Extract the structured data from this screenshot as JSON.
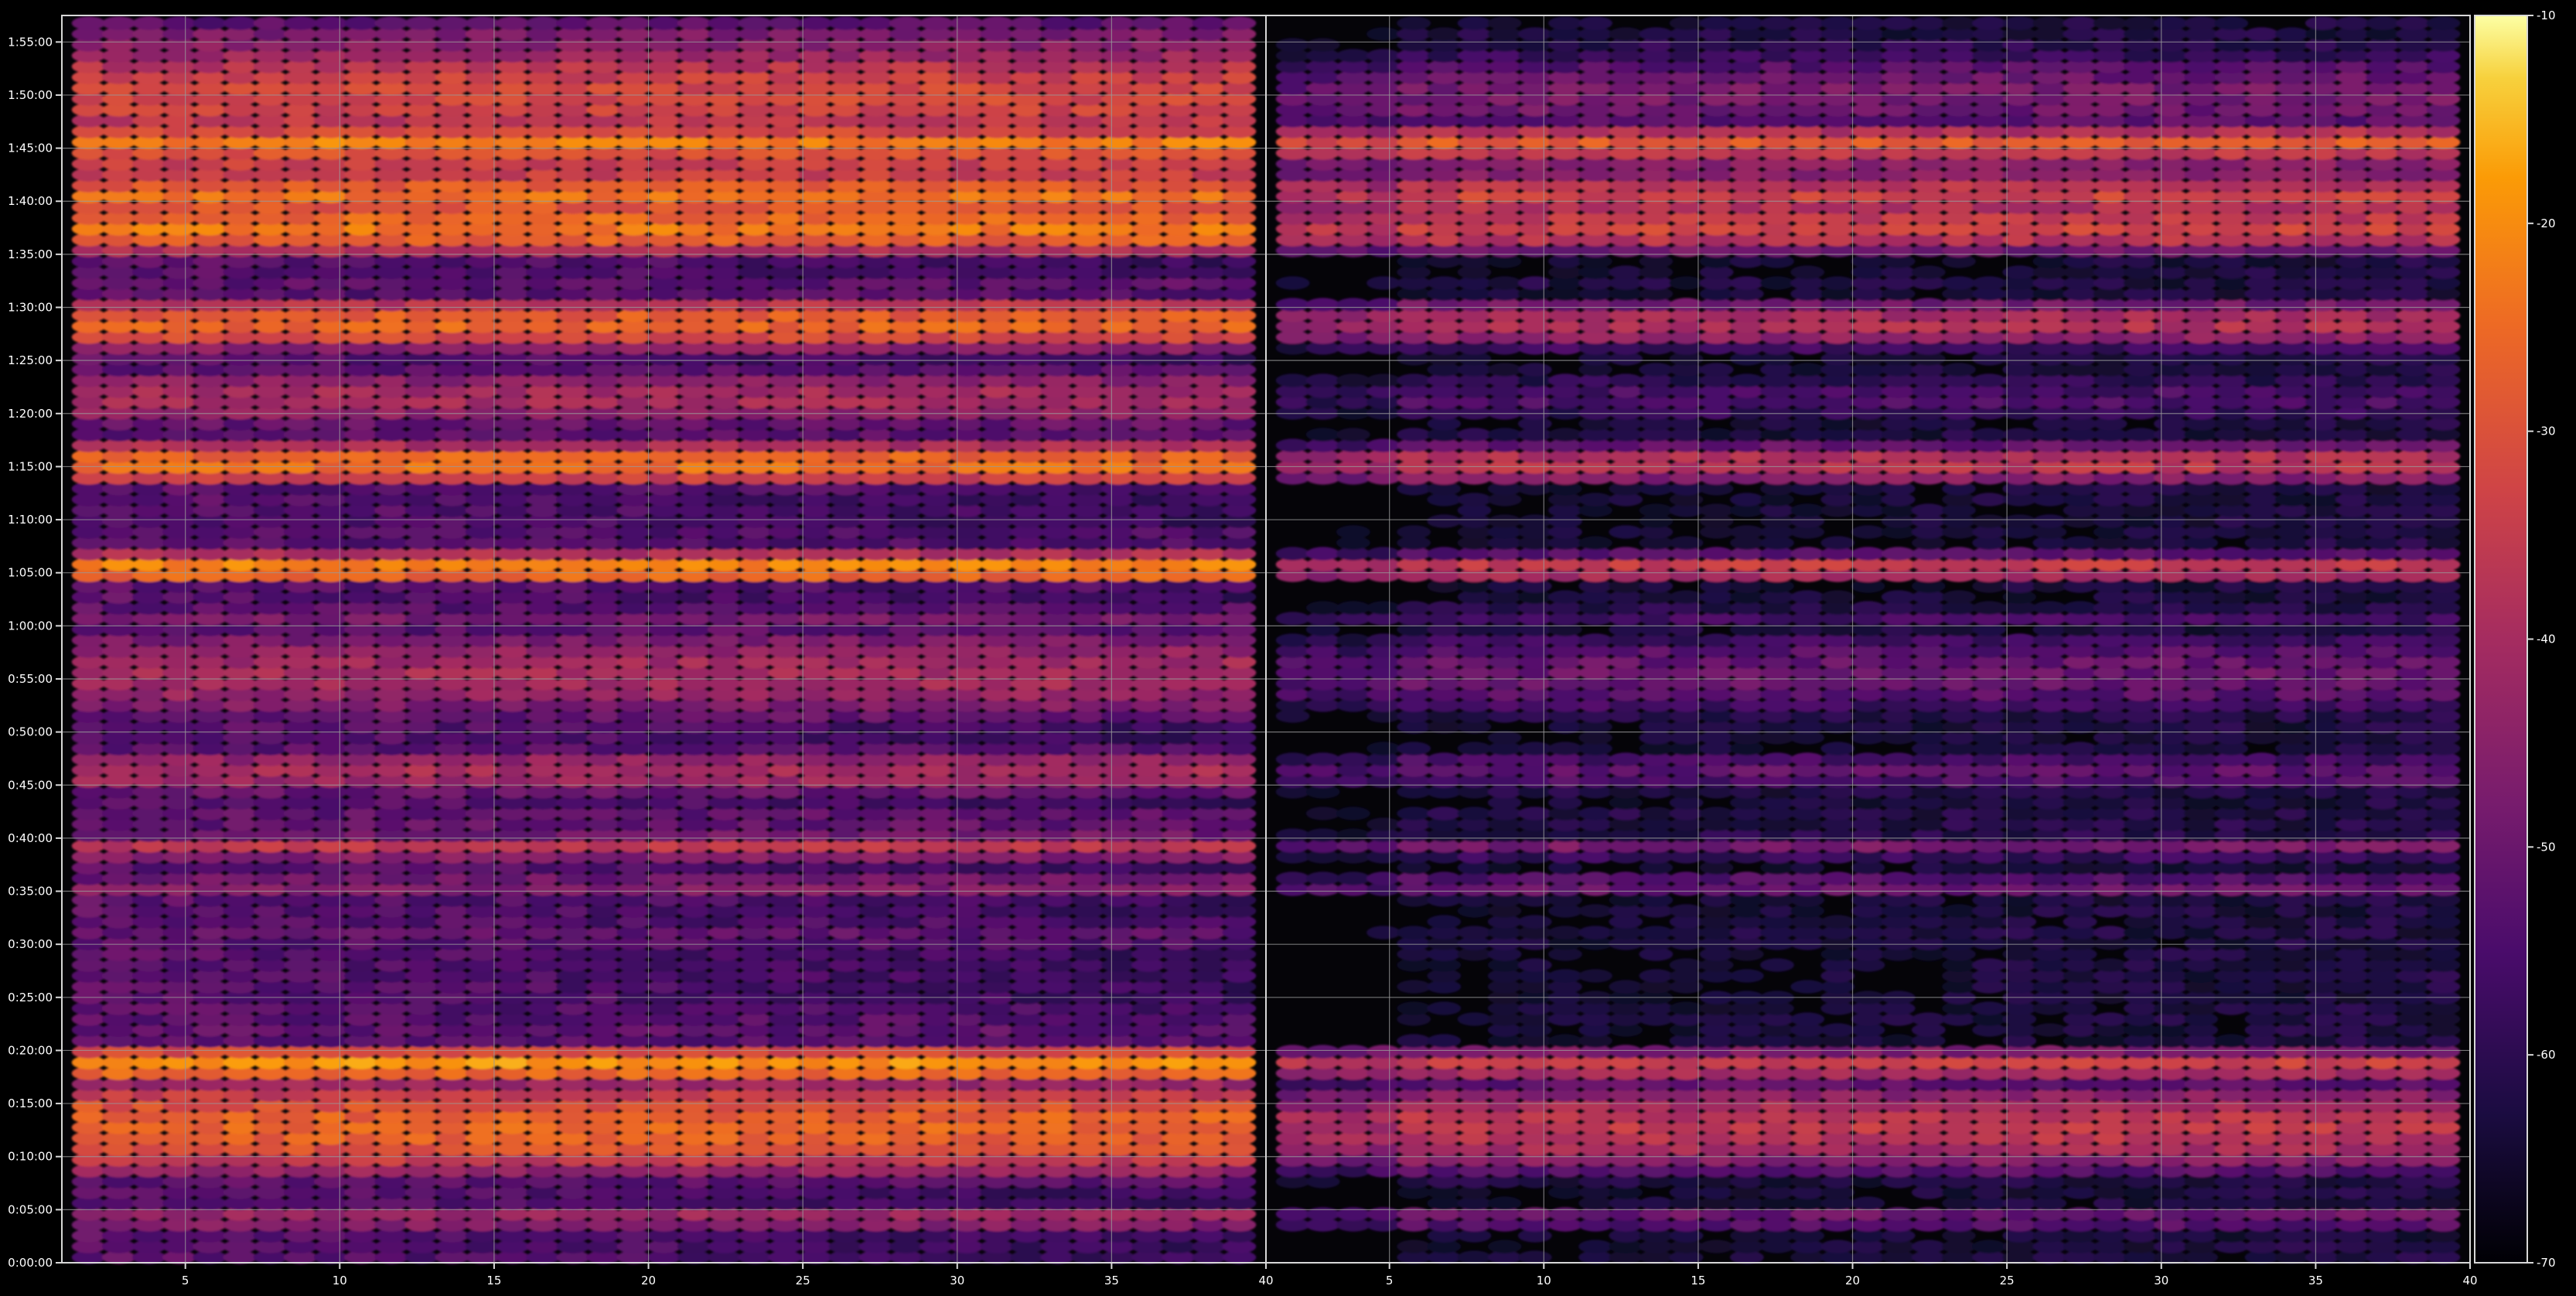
{
  "chart_data": {
    "type": "heatmap",
    "title": "",
    "panels": [
      {
        "xlim": [
          1,
          40
        ],
        "xticks": [
          "5",
          "10",
          "15",
          "20",
          "25",
          "30",
          "35",
          "40"
        ]
      },
      {
        "xlim": [
          1,
          40
        ],
        "xticks": [
          "5",
          "10",
          "15",
          "20",
          "25",
          "30",
          "35",
          "40"
        ]
      }
    ],
    "yticks": [
      "0:00:00",
      "0:05:00",
      "0:10:00",
      "0:15:00",
      "0:20:00",
      "0:25:00",
      "0:30:00",
      "0:35:00",
      "0:40:00",
      "0:45:00",
      "0:50:00",
      "0:55:00",
      "1:00:00",
      "1:05:00",
      "1:10:00",
      "1:15:00",
      "1:20:00",
      "1:25:00",
      "1:30:00",
      "1:35:00",
      "1:40:00",
      "1:45:00",
      "1:50:00",
      "1:55:00"
    ],
    "ylim_minutes": [
      0,
      117.5
    ],
    "colorbar": {
      "ticks": [
        "-10",
        "-20",
        "-30",
        "-40",
        "-50",
        "-60",
        "-70"
      ],
      "vmin": -70,
      "vmax": -10,
      "cmap": "inferno"
    },
    "grid": true,
    "bands": [
      {
        "t": 4.2,
        "left": -40,
        "right": -48,
        "w": 0.8
      },
      {
        "t": 9.5,
        "left": -50,
        "right": -58,
        "w": 1.8
      },
      {
        "t": 12.8,
        "left": -26,
        "right": -36,
        "w": 3.0
      },
      {
        "t": 18.7,
        "left": -19,
        "right": -34,
        "w": 1.0
      },
      {
        "t": 22,
        "left": -52,
        "right": -64,
        "w": 3.0
      },
      {
        "t": 27.5,
        "left": -55,
        "right": -65,
        "w": 0.8
      },
      {
        "t": 31,
        "left": -52,
        "right": -62,
        "w": 2.0
      },
      {
        "t": 35.5,
        "left": -45,
        "right": -50,
        "w": 1.0
      },
      {
        "t": 39.2,
        "left": -36,
        "right": -48,
        "w": 0.9
      },
      {
        "t": 41.8,
        "left": -50,
        "right": -60,
        "w": 1.2
      },
      {
        "t": 46.3,
        "left": -40,
        "right": -52,
        "w": 1.8
      },
      {
        "t": 55.5,
        "left": -40,
        "right": -50,
        "w": 3.5
      },
      {
        "t": 60.8,
        "left": -48,
        "right": -56,
        "w": 1.2
      },
      {
        "t": 65.5,
        "left": -20,
        "right": -34,
        "w": 0.9
      },
      {
        "t": 68.3,
        "left": -52,
        "right": -62,
        "w": 1.0
      },
      {
        "t": 75.3,
        "left": -24,
        "right": -36,
        "w": 1.3
      },
      {
        "t": 78.3,
        "left": -52,
        "right": -62,
        "w": 1.2
      },
      {
        "t": 81.5,
        "left": -40,
        "right": -55,
        "w": 2.2
      },
      {
        "t": 88.5,
        "left": -26,
        "right": -38,
        "w": 1.6
      },
      {
        "t": 92.5,
        "left": -52,
        "right": -62,
        "w": 1.0
      },
      {
        "t": 97.5,
        "left": -23,
        "right": -33,
        "w": 1.6
      },
      {
        "t": 100.5,
        "left": -24,
        "right": -33,
        "w": 1.4
      },
      {
        "t": 103,
        "left": -33,
        "right": -44,
        "w": 1.4
      },
      {
        "t": 105.5,
        "left": -22,
        "right": -28,
        "w": 1.0
      },
      {
        "t": 110,
        "left": -32,
        "right": -48,
        "w": 3.5
      },
      {
        "t": 114.5,
        "left": -45,
        "right": -60,
        "w": 2.5
      }
    ]
  }
}
